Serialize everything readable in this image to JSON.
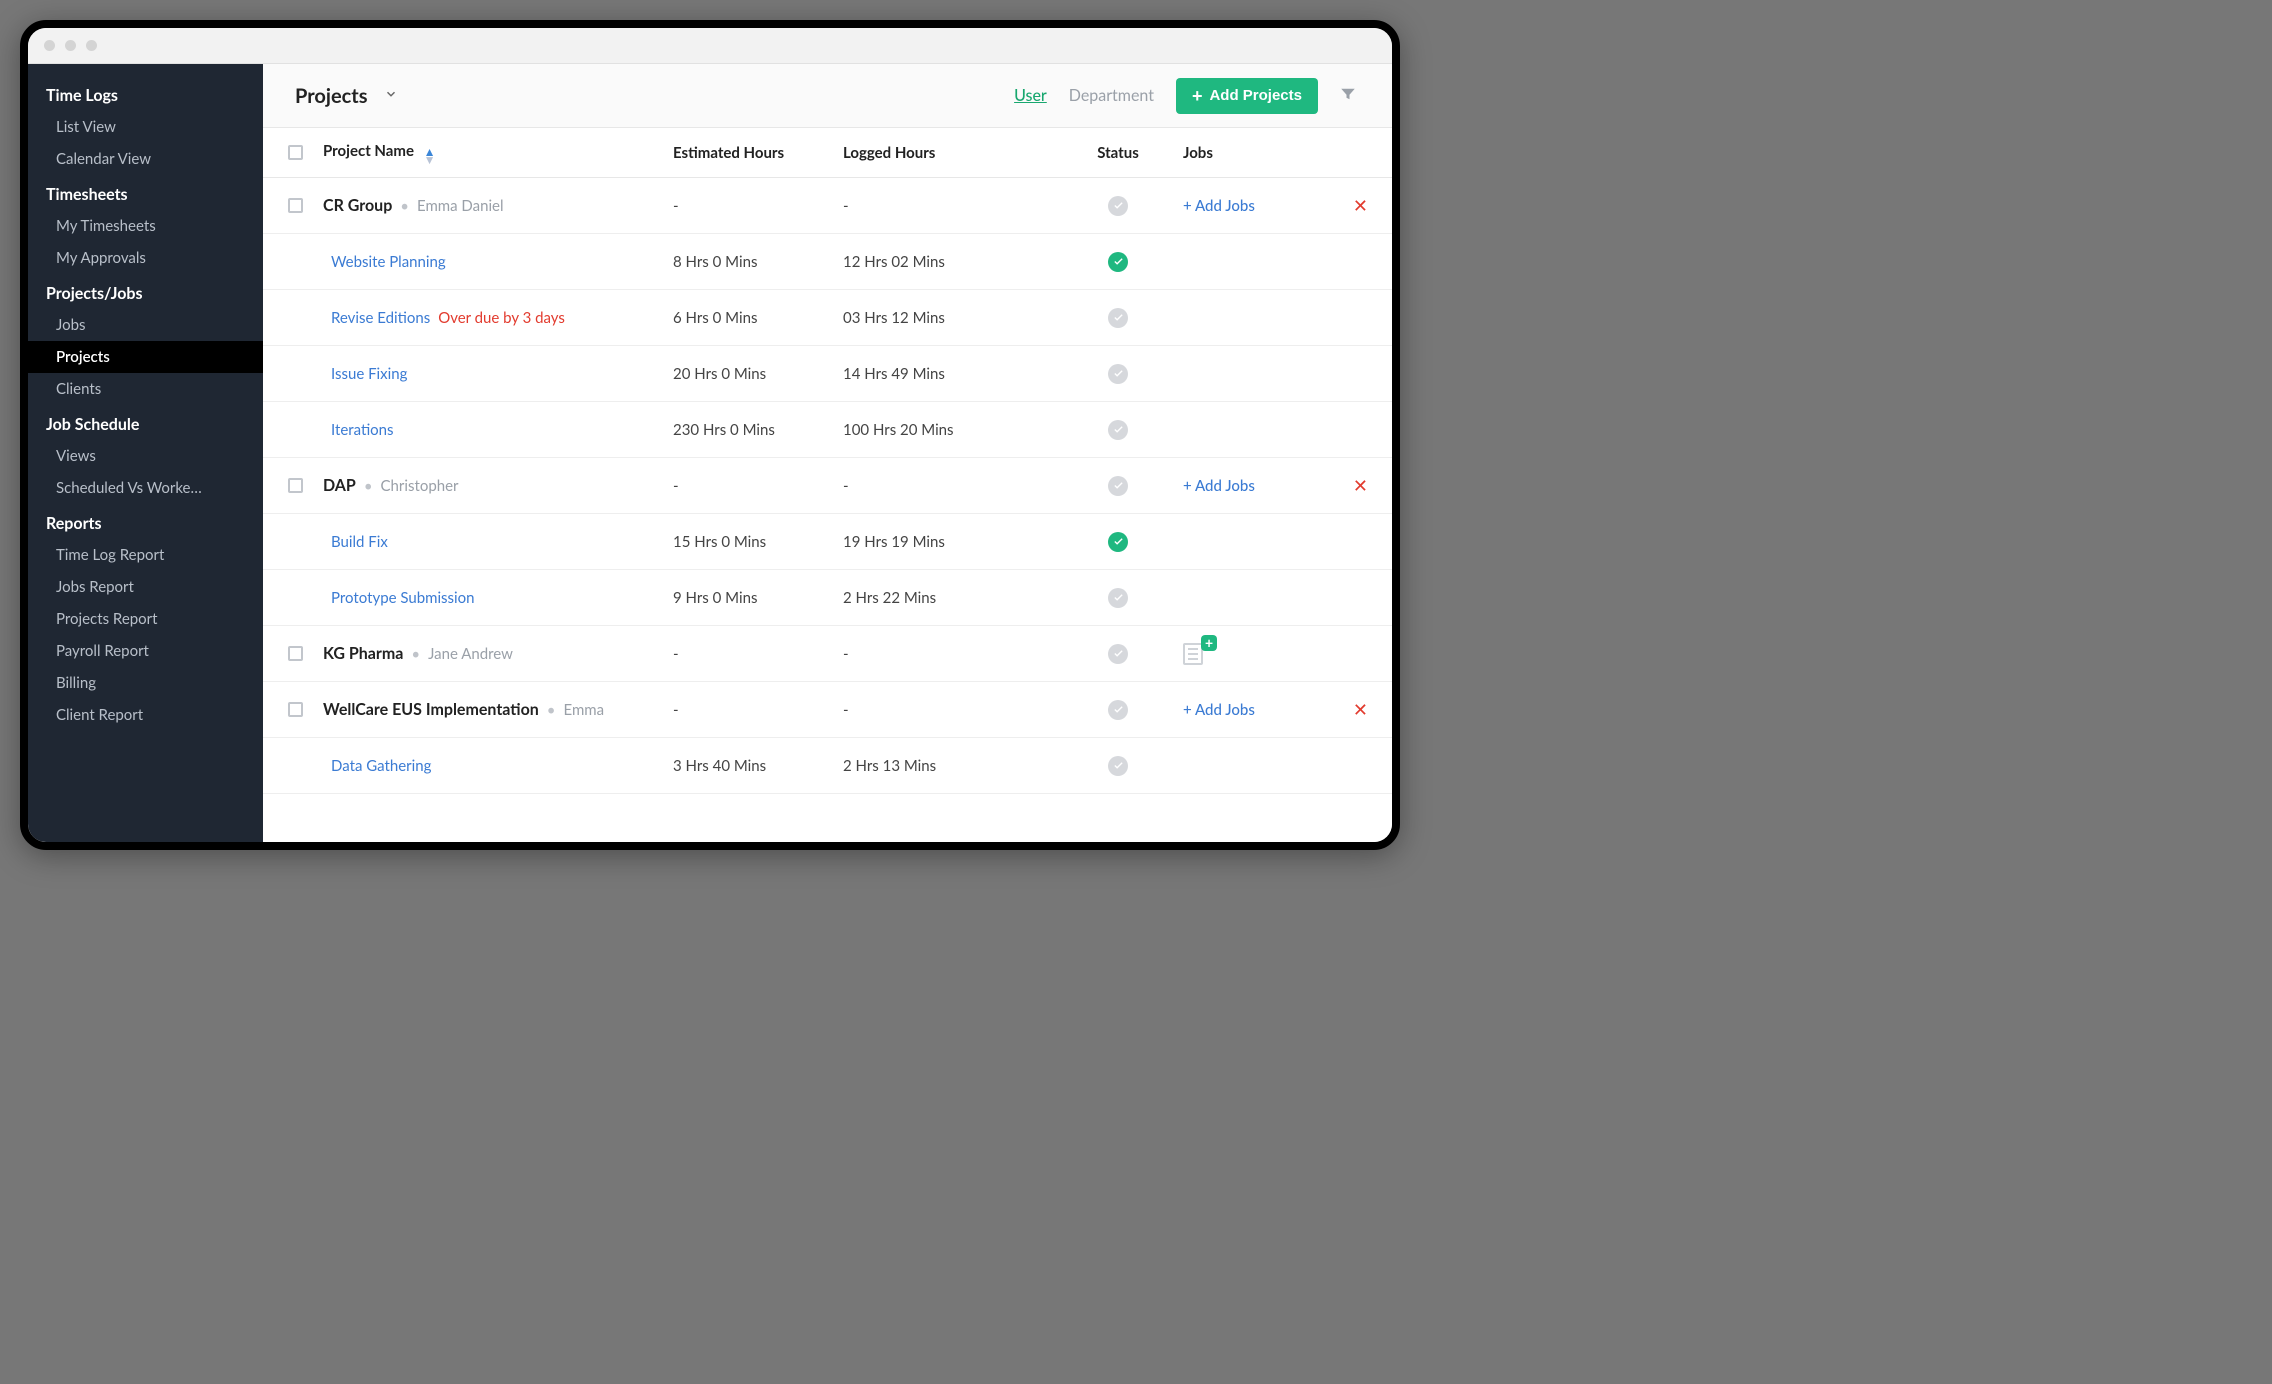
{
  "sidebar": {
    "sections": [
      {
        "title": "Time Logs",
        "items": [
          "List View",
          "Calendar View"
        ]
      },
      {
        "title": "Timesheets",
        "items": [
          "My Timesheets",
          "My Approvals"
        ]
      },
      {
        "title": "Projects/Jobs",
        "items": [
          "Jobs",
          "Projects",
          "Clients"
        ],
        "activeIndex": 1
      },
      {
        "title": "Job Schedule",
        "items": [
          "Views",
          "Scheduled Vs Worke…"
        ]
      },
      {
        "title": "Reports",
        "items": [
          "Time Log Report",
          "Jobs Report",
          "Projects Report",
          "Payroll Report",
          "Billing",
          "Client Report"
        ]
      }
    ]
  },
  "header": {
    "title": "Projects",
    "tab_user": "User",
    "tab_department": "Department",
    "add_button": "Add Projects"
  },
  "columns": {
    "project_name": "Project Name",
    "estimated": "Estimated Hours",
    "logged": "Logged Hours",
    "status": "Status",
    "jobs": "Jobs"
  },
  "labels": {
    "add_jobs": "+ Add Jobs"
  },
  "projects": [
    {
      "name": "CR Group",
      "owner": "Emma Daniel",
      "est": "-",
      "log": "-",
      "status": "gray",
      "addJobs": true,
      "delete": true,
      "jobs": [
        {
          "name": "Website Planning",
          "est": "8 Hrs 0 Mins",
          "log": "12 Hrs 02 Mins",
          "status": "green"
        },
        {
          "name": "Revise Editions",
          "overdue": "Over due by 3 days",
          "est": "6 Hrs 0 Mins",
          "log": "03 Hrs 12 Mins",
          "status": "gray"
        },
        {
          "name": "Issue Fixing",
          "est": "20 Hrs 0 Mins",
          "log": "14 Hrs 49 Mins",
          "status": "gray"
        },
        {
          "name": "Iterations",
          "est": "230 Hrs 0 Mins",
          "log": "100 Hrs 20 Mins",
          "status": "gray"
        }
      ]
    },
    {
      "name": "DAP",
      "owner": "Christopher",
      "est": "-",
      "log": "-",
      "status": "gray",
      "addJobs": true,
      "delete": true,
      "jobs": [
        {
          "name": "Build Fix",
          "est": "15 Hrs 0 Mins",
          "log": "19 Hrs 19 Mins",
          "status": "green"
        },
        {
          "name": "Prototype Submission",
          "est": "9 Hrs 0 Mins",
          "log": "2 Hrs 22 Mins",
          "status": "gray"
        }
      ]
    },
    {
      "name": "KG Pharma",
      "owner": "Jane Andrew",
      "est": "-",
      "log": "-",
      "status": "gray",
      "jobsBadge": true,
      "jobs": []
    },
    {
      "name": "WellCare EUS Implementation",
      "owner": "Emma",
      "est": "-",
      "log": "-",
      "status": "gray",
      "addJobs": true,
      "delete": true,
      "jobs": [
        {
          "name": "Data Gathering",
          "est": "3 Hrs 40 Mins",
          "log": "2 Hrs 13 Mins",
          "status": "gray"
        }
      ]
    }
  ]
}
